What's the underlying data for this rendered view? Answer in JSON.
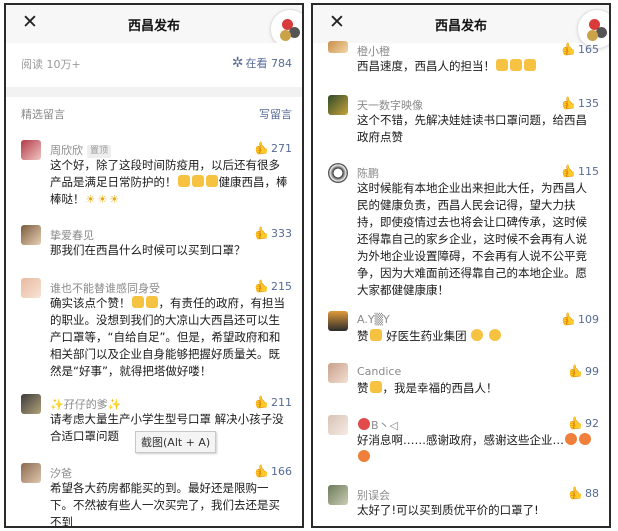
{
  "app": {
    "title": "西昌发布"
  },
  "left": {
    "read_count": "阅读 10万+",
    "zaikan_label": "在看 784",
    "section_title": "精选留言",
    "write_link": "写留言",
    "tooltip": "截图(Alt + A)",
    "comments": [
      {
        "nick": "周欣欣",
        "tag": "置顶",
        "likes": "271",
        "text": "这个好，除了这段时间防疫用，以后还有很多产品是满足日常防护的！",
        "text2": "健康西昌，棒棒哒！"
      },
      {
        "nick": "挚爱春见",
        "likes": "333",
        "text": "那我们在西昌什么时候可以买到口罩？"
      },
      {
        "nick": "谁也不能替谁感同身受",
        "likes": "215",
        "text": "确实该点个赞！",
        "text2": "，有责任的政府，有担当的职业。没想到我们的大凉山大西昌还可以生产口罩等，“自给自足”。但是，希望政府和和相关部门以及企业自身能够把握好质量关。既然是“好事”，就得把塔做好喽！"
      },
      {
        "nick": "✨孖仔的爹✨",
        "likes": "211",
        "text": "请考虑大量生产小学生型号口罩 解决小孩子没合适口罩问题"
      },
      {
        "nick": "汐爸",
        "likes": "166",
        "text": "希望各大药房都能买的到。最好还是限购一下。不然被有些人一次买完了，我们去还是买不到"
      }
    ]
  },
  "right": {
    "comments": [
      {
        "nick": "橙小橙",
        "likes": "165",
        "text": "西昌速度，西昌人的担当！"
      },
      {
        "nick": "天一数字映像",
        "likes": "135",
        "text": "这个不错，先解决娃娃读书口罩问题，给西昌政府点赞"
      },
      {
        "nick": "陈鹏",
        "likes": "115",
        "text": "这时候能有本地企业出来担此大任，为西昌人民的健康负责，西昌人民会记得，望大力扶持，即使疫情过去也将会让口碑传承，这时候还得靠自己的家乡企业，这时候不会再有人说为外地企业设置障碍，不会再有人说不公平竞争，因为大难面前还得靠自己的本地企业。愿大家都健健康康！"
      },
      {
        "nick": "A.Y▒Y",
        "likes": "109",
        "text": "赞",
        "text2": "好医生药业集团"
      },
      {
        "nick": "Candice",
        "likes": "99",
        "text": "赞",
        "text2": "，我是幸福的西昌人！"
      },
      {
        "nick": "B丶◁",
        "likes": "92",
        "text": "好消息啊……感谢政府，感谢这些企业…"
      },
      {
        "nick": "别误会",
        "likes": "88",
        "text": "太好了!可以买到质优平价的口罩了!"
      }
    ]
  },
  "colors": {
    "link": "#576b95",
    "meta": "#8a8a8a",
    "band": "#f2f2f2"
  }
}
